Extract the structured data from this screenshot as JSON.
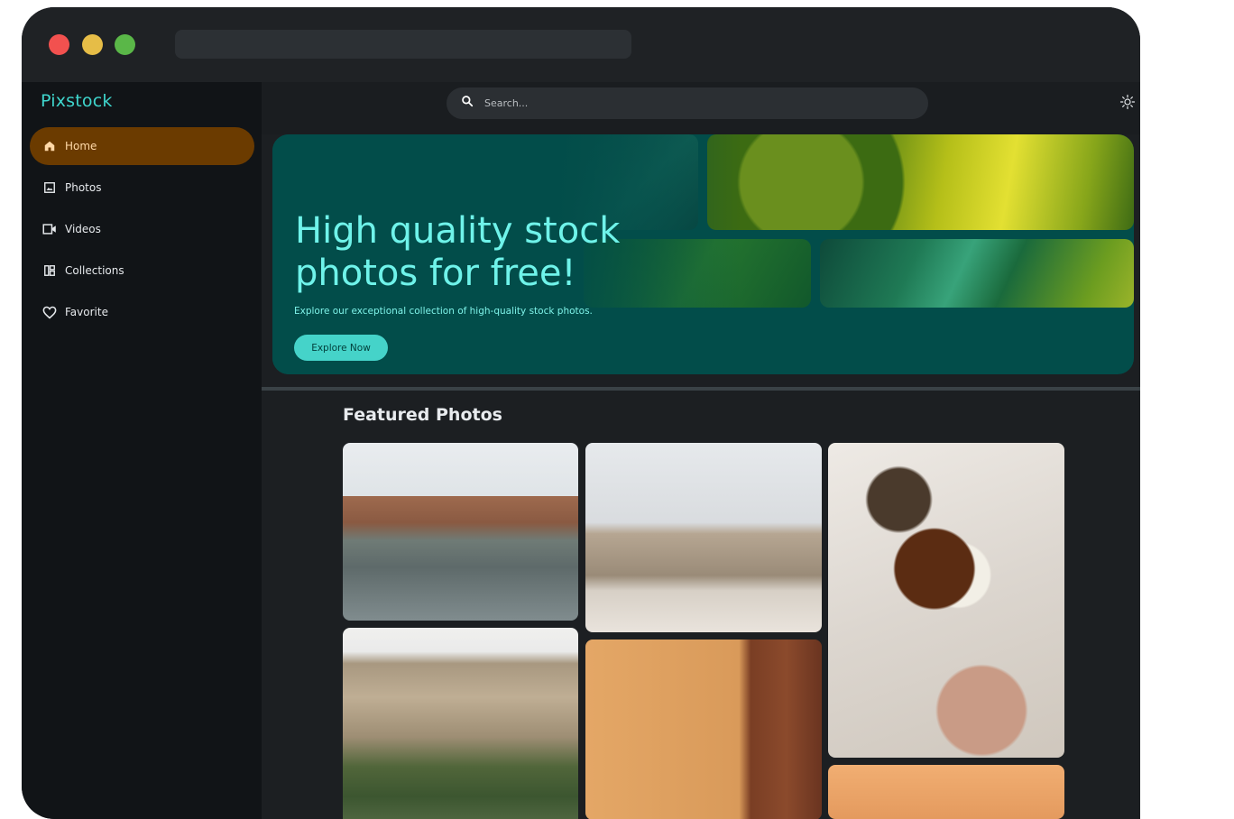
{
  "app": {
    "brand": "Pixstock"
  },
  "sidebar": {
    "items": [
      {
        "label": "Home",
        "icon": "home-icon",
        "active": true
      },
      {
        "label": "Photos",
        "icon": "image-icon",
        "active": false
      },
      {
        "label": "Videos",
        "icon": "video-icon",
        "active": false
      },
      {
        "label": "Collections",
        "icon": "collections-icon",
        "active": false
      },
      {
        "label": "Favorite",
        "icon": "heart-icon",
        "active": false
      }
    ]
  },
  "search": {
    "placeholder": "Search...",
    "icon": "search-icon"
  },
  "theme_toggle": {
    "icon": "sun-icon"
  },
  "hero": {
    "title": "High quality stock photos for free!",
    "subtitle": "Explore our exceptional collection of high-quality stock photos.",
    "button": "Explore Now"
  },
  "featured": {
    "title": "Featured Photos",
    "photos": [
      {
        "alt": "canal-harbor"
      },
      {
        "alt": "st-peters-square"
      },
      {
        "alt": "cat-breakfast-bed"
      },
      {
        "alt": "limestone-cliff"
      },
      {
        "alt": "orange-wall-wooden-door"
      },
      {
        "alt": "orange-photo"
      }
    ]
  },
  "colors": {
    "accent": "#3fd6cd",
    "active_nav": "#6b3b00",
    "hero_bg": "#024d4a",
    "sidebar_bg": "#111417"
  }
}
